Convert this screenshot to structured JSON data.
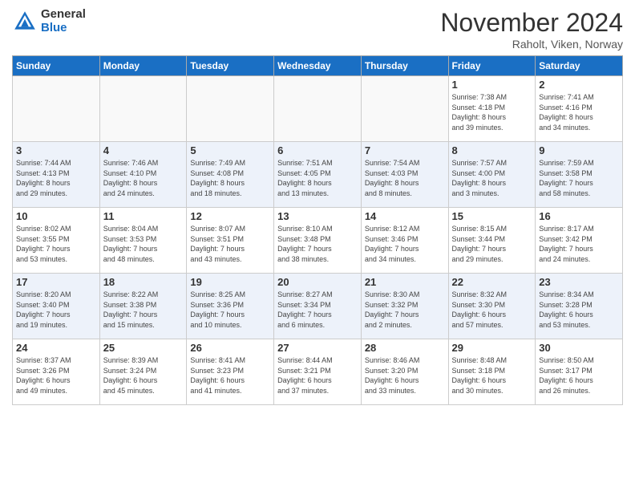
{
  "logo": {
    "general": "General",
    "blue": "Blue"
  },
  "title": "November 2024",
  "location": "Raholt, Viken, Norway",
  "days_header": [
    "Sunday",
    "Monday",
    "Tuesday",
    "Wednesday",
    "Thursday",
    "Friday",
    "Saturday"
  ],
  "weeks": [
    [
      {
        "num": "",
        "info": ""
      },
      {
        "num": "",
        "info": ""
      },
      {
        "num": "",
        "info": ""
      },
      {
        "num": "",
        "info": ""
      },
      {
        "num": "",
        "info": ""
      },
      {
        "num": "1",
        "info": "Sunrise: 7:38 AM\nSunset: 4:18 PM\nDaylight: 8 hours\nand 39 minutes."
      },
      {
        "num": "2",
        "info": "Sunrise: 7:41 AM\nSunset: 4:16 PM\nDaylight: 8 hours\nand 34 minutes."
      }
    ],
    [
      {
        "num": "3",
        "info": "Sunrise: 7:44 AM\nSunset: 4:13 PM\nDaylight: 8 hours\nand 29 minutes."
      },
      {
        "num": "4",
        "info": "Sunrise: 7:46 AM\nSunset: 4:10 PM\nDaylight: 8 hours\nand 24 minutes."
      },
      {
        "num": "5",
        "info": "Sunrise: 7:49 AM\nSunset: 4:08 PM\nDaylight: 8 hours\nand 18 minutes."
      },
      {
        "num": "6",
        "info": "Sunrise: 7:51 AM\nSunset: 4:05 PM\nDaylight: 8 hours\nand 13 minutes."
      },
      {
        "num": "7",
        "info": "Sunrise: 7:54 AM\nSunset: 4:03 PM\nDaylight: 8 hours\nand 8 minutes."
      },
      {
        "num": "8",
        "info": "Sunrise: 7:57 AM\nSunset: 4:00 PM\nDaylight: 8 hours\nand 3 minutes."
      },
      {
        "num": "9",
        "info": "Sunrise: 7:59 AM\nSunset: 3:58 PM\nDaylight: 7 hours\nand 58 minutes."
      }
    ],
    [
      {
        "num": "10",
        "info": "Sunrise: 8:02 AM\nSunset: 3:55 PM\nDaylight: 7 hours\nand 53 minutes."
      },
      {
        "num": "11",
        "info": "Sunrise: 8:04 AM\nSunset: 3:53 PM\nDaylight: 7 hours\nand 48 minutes."
      },
      {
        "num": "12",
        "info": "Sunrise: 8:07 AM\nSunset: 3:51 PM\nDaylight: 7 hours\nand 43 minutes."
      },
      {
        "num": "13",
        "info": "Sunrise: 8:10 AM\nSunset: 3:48 PM\nDaylight: 7 hours\nand 38 minutes."
      },
      {
        "num": "14",
        "info": "Sunrise: 8:12 AM\nSunset: 3:46 PM\nDaylight: 7 hours\nand 34 minutes."
      },
      {
        "num": "15",
        "info": "Sunrise: 8:15 AM\nSunset: 3:44 PM\nDaylight: 7 hours\nand 29 minutes."
      },
      {
        "num": "16",
        "info": "Sunrise: 8:17 AM\nSunset: 3:42 PM\nDaylight: 7 hours\nand 24 minutes."
      }
    ],
    [
      {
        "num": "17",
        "info": "Sunrise: 8:20 AM\nSunset: 3:40 PM\nDaylight: 7 hours\nand 19 minutes."
      },
      {
        "num": "18",
        "info": "Sunrise: 8:22 AM\nSunset: 3:38 PM\nDaylight: 7 hours\nand 15 minutes."
      },
      {
        "num": "19",
        "info": "Sunrise: 8:25 AM\nSunset: 3:36 PM\nDaylight: 7 hours\nand 10 minutes."
      },
      {
        "num": "20",
        "info": "Sunrise: 8:27 AM\nSunset: 3:34 PM\nDaylight: 7 hours\nand 6 minutes."
      },
      {
        "num": "21",
        "info": "Sunrise: 8:30 AM\nSunset: 3:32 PM\nDaylight: 7 hours\nand 2 minutes."
      },
      {
        "num": "22",
        "info": "Sunrise: 8:32 AM\nSunset: 3:30 PM\nDaylight: 6 hours\nand 57 minutes."
      },
      {
        "num": "23",
        "info": "Sunrise: 8:34 AM\nSunset: 3:28 PM\nDaylight: 6 hours\nand 53 minutes."
      }
    ],
    [
      {
        "num": "24",
        "info": "Sunrise: 8:37 AM\nSunset: 3:26 PM\nDaylight: 6 hours\nand 49 minutes."
      },
      {
        "num": "25",
        "info": "Sunrise: 8:39 AM\nSunset: 3:24 PM\nDaylight: 6 hours\nand 45 minutes."
      },
      {
        "num": "26",
        "info": "Sunrise: 8:41 AM\nSunset: 3:23 PM\nDaylight: 6 hours\nand 41 minutes."
      },
      {
        "num": "27",
        "info": "Sunrise: 8:44 AM\nSunset: 3:21 PM\nDaylight: 6 hours\nand 37 minutes."
      },
      {
        "num": "28",
        "info": "Sunrise: 8:46 AM\nSunset: 3:20 PM\nDaylight: 6 hours\nand 33 minutes."
      },
      {
        "num": "29",
        "info": "Sunrise: 8:48 AM\nSunset: 3:18 PM\nDaylight: 6 hours\nand 30 minutes."
      },
      {
        "num": "30",
        "info": "Sunrise: 8:50 AM\nSunset: 3:17 PM\nDaylight: 6 hours\nand 26 minutes."
      }
    ]
  ]
}
